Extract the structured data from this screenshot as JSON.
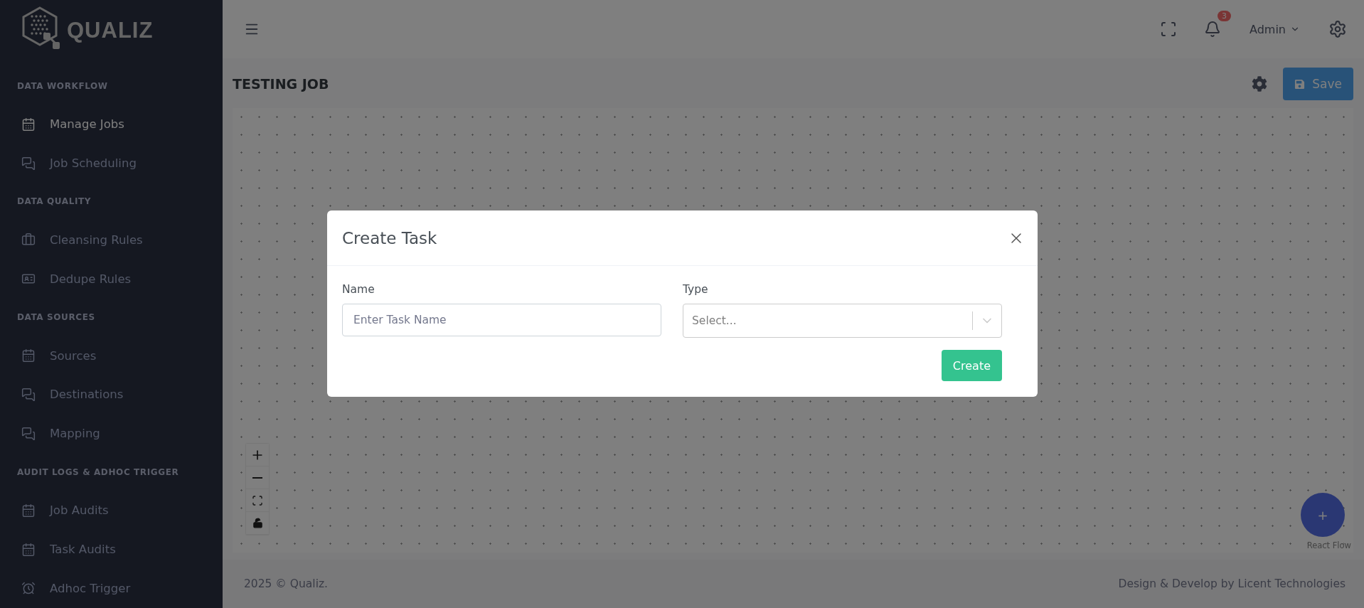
{
  "sidebar": {
    "logo": "QUALIZ",
    "sections": [
      {
        "title": "DATA WORKFLOW",
        "items": [
          {
            "label": "Manage Jobs",
            "kind": "calendar",
            "selected": true
          },
          {
            "label": "Job Scheduling",
            "kind": "chat",
            "selected": false
          }
        ]
      },
      {
        "title": "DATA QUALITY",
        "items": [
          {
            "label": "Cleansing Rules",
            "kind": "briefcase",
            "selected": false
          },
          {
            "label": "Dedupe Rules",
            "kind": "card",
            "selected": false
          }
        ]
      },
      {
        "title": "DATA SOURCES",
        "items": [
          {
            "label": "Sources",
            "kind": "calendar",
            "selected": false
          },
          {
            "label": "Destinations",
            "kind": "chat",
            "selected": false
          },
          {
            "label": "Mapping",
            "kind": "chat",
            "selected": false
          }
        ]
      },
      {
        "title": "AUDIT LOGS & ADHOC TRIGGER",
        "items": [
          {
            "label": "Job Audits",
            "kind": "calendar",
            "selected": false
          },
          {
            "label": "Task Audits",
            "kind": "calendar",
            "selected": false
          },
          {
            "label": "Adhoc Trigger",
            "kind": "alarm",
            "selected": false
          }
        ]
      }
    ]
  },
  "topbar": {
    "notification_count": "3",
    "user": "Admin"
  },
  "page": {
    "title": "TESTING JOB",
    "save_button": "Save"
  },
  "canvas": {
    "add_button": "+",
    "attribution": "React Flow"
  },
  "modal": {
    "title": "Create Task",
    "fields": [
      {
        "kind": "text",
        "label": "Name",
        "placeholder": "Enter Task Name"
      },
      {
        "kind": "select",
        "label": "Type",
        "placeholder": "Select..."
      }
    ],
    "submit": "Create"
  },
  "footer": {
    "left": "2025 © Qualiz.",
    "right": "Design & Develop by Licent Technologies"
  }
}
